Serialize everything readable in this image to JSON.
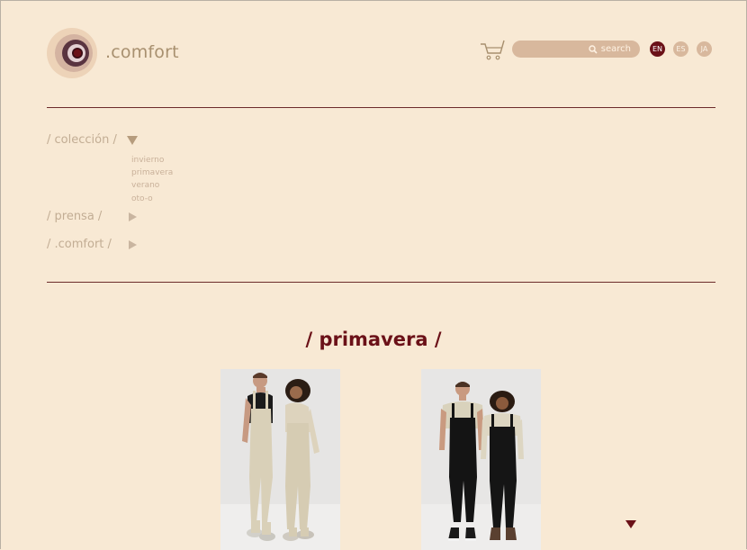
{
  "header": {
    "brand": ".comfort",
    "search_label": "search",
    "languages": [
      {
        "code": "EN",
        "active": true
      },
      {
        "code": "ES",
        "active": false
      },
      {
        "code": "JA",
        "active": false
      }
    ]
  },
  "nav": {
    "items": [
      {
        "label": "/ colección /",
        "expanded": true,
        "icon": "triangle-down-icon"
      },
      {
        "label": "/ prensa /",
        "expanded": false,
        "icon": "triangle-right-icon"
      },
      {
        "label": "/ .comfort /",
        "expanded": false,
        "icon": "triangle-right-icon"
      }
    ],
    "subitems": [
      "invierno",
      "primavera",
      "verano",
      "oto-o"
    ]
  },
  "main": {
    "title": "/ primavera /",
    "photos": [
      {
        "name": "photo-model-pair-beige-overalls"
      },
      {
        "name": "photo-model-pair-black-overalls"
      }
    ]
  },
  "colors": {
    "background": "#f8e9d4",
    "accent": "#6b1118",
    "muted": "#d8b89d"
  }
}
